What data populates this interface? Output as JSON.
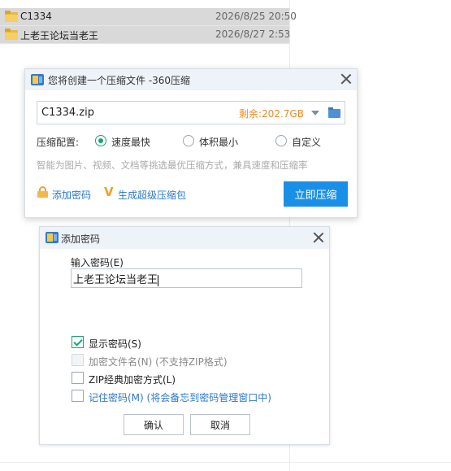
{
  "files": [
    {
      "name": "C1334",
      "date": "2026/8/25 20:50"
    },
    {
      "name": "上老王论坛当老王",
      "date": "2026/8/27 2:53"
    }
  ],
  "compress_dialog": {
    "title": "您将创建一个压缩文件 -360压缩",
    "path_value": "C1334.zip",
    "remaining": "剩余:202.7GB",
    "config_label": "压缩配置:",
    "options": [
      {
        "label": "速度最快",
        "selected": true
      },
      {
        "label": "体积最小",
        "selected": false
      },
      {
        "label": "自定义",
        "selected": false
      }
    ],
    "hint": "智能为图片、视频、文档等挑选最优压缩方式，兼具速度和压缩率",
    "add_password_link": "添加密码",
    "super_package_link": "生成超级压缩包",
    "compress_button": "立即压缩",
    "icons": [
      "app-icon",
      "close-icon",
      "dropdown-arrow-icon",
      "folder-icon",
      "lock-icon",
      "v-badge-icon"
    ]
  },
  "password_dialog": {
    "title": "添加密码",
    "input_label": "输入密码(E)",
    "password_value": "上老王论坛当老王",
    "checkboxes": [
      {
        "label": "显示密码(S)",
        "checked": true,
        "disabled": false
      },
      {
        "label": "加密文件名(N) (不支持ZIP格式)",
        "checked": false,
        "disabled": true
      },
      {
        "label": "ZIP经典加密方式(L)",
        "checked": false,
        "disabled": false
      },
      {
        "label": "记住密码(M) (将会备忘到密码管理窗口中)",
        "checked": false,
        "disabled": false
      }
    ],
    "ok_button": "确认",
    "cancel_button": "取消"
  },
  "colors": {
    "accent": "#1a8fe8",
    "remaining": "#f08a24",
    "check_green": "#1aa36f",
    "link_blue": "#2a78c8"
  }
}
